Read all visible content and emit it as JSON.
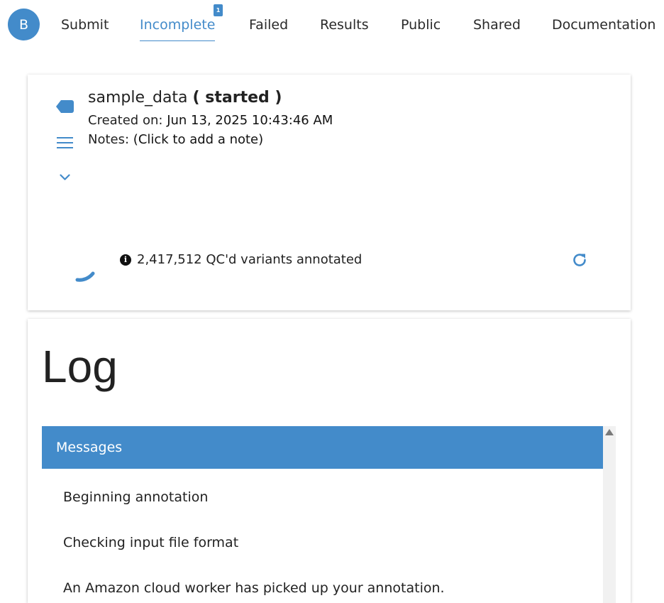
{
  "user": {
    "avatar_initial": "B"
  },
  "nav": {
    "tabs": [
      {
        "label": "Submit"
      },
      {
        "label": "Incomplete",
        "badge": "1"
      },
      {
        "label": "Failed"
      },
      {
        "label": "Results"
      },
      {
        "label": "Public"
      },
      {
        "label": "Shared"
      },
      {
        "label": "Documentation"
      }
    ],
    "active_tab": "Incomplete"
  },
  "job": {
    "name": "sample_data",
    "status": "( started )",
    "created_label": "Created on:",
    "created_value": "Jun 13, 2025 10:43:46 AM",
    "notes_label": "Notes:",
    "notes_value": "(Click to add a note)",
    "progress_text": "2,417,512 QC'd variants annotated"
  },
  "log": {
    "title": "Log",
    "messages_header": "Messages",
    "messages": [
      "Beginning annotation",
      "Checking input file format",
      "An Amazon cloud worker has picked up your annotation."
    ]
  },
  "colors": {
    "accent": "#438bca",
    "text": "#222222"
  },
  "icons": [
    "tag-icon",
    "menu-icon",
    "chevron-down-icon",
    "spinner-icon",
    "info-icon",
    "refresh-icon",
    "scroll-up-arrow-icon"
  ]
}
